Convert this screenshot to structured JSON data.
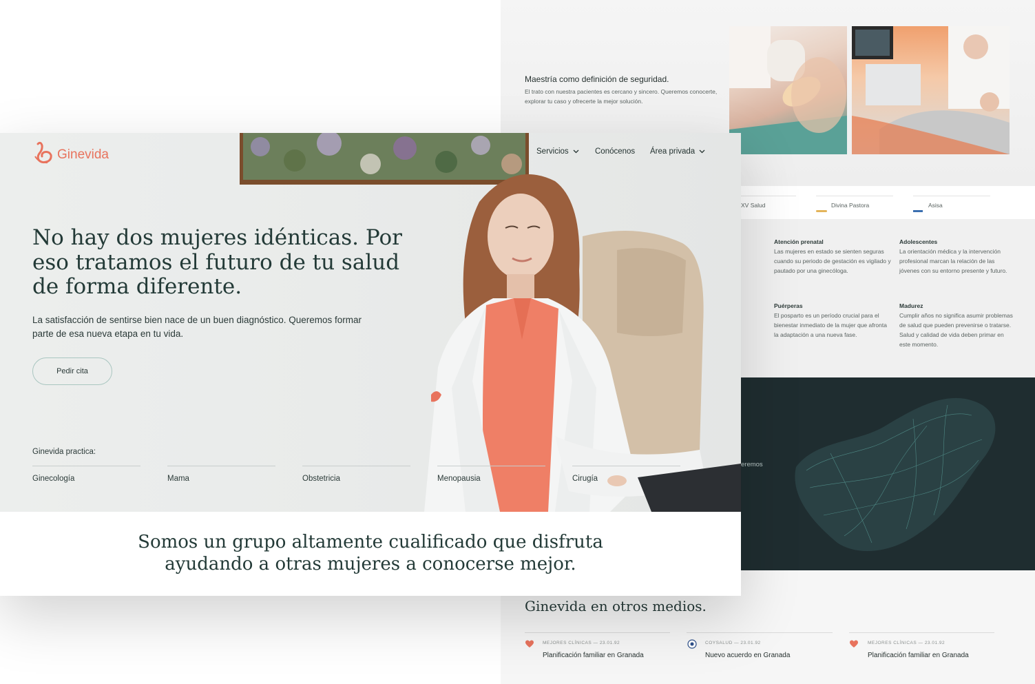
{
  "colors": {
    "accent": "#e8735d",
    "dark_panel": "#1f2d30",
    "text": "#233a37",
    "button_border": "#a9c6c0"
  },
  "back": {
    "feature": {
      "title": "Maestría como definición de seguridad.",
      "text": "El trato con nuestra pacientes es cercano y sincero. Queremos conocerte, explorar tu caso y ofrecerte la mejor solución."
    },
    "partners": [
      "XV Salud",
      "Divina Pastora",
      "Asisa"
    ],
    "services": [
      {
        "title": "Atención prenatal",
        "text": "Las mujeres en estado se sienten seguras cuando su periodo de gestación es vigilado y pautado por una ginecóloga."
      },
      {
        "title": "Adolescentes",
        "text": "La orientación médica y la intervención profesional marcan la relación de las jóvenes con su entorno presente y futuro."
      },
      {
        "title": "Puérperas",
        "text": "El posparto es un período crucial para el bienestar inmediato de la mujer que afronta la adaptación a una nueva fase."
      },
      {
        "title": "Madurez",
        "text": "Cumplir años no significa asumir problemas de salud que pueden prevenirse o tratarse. Salud y calidad de vida deben primar en este momento."
      }
    ],
    "map_fragment": "eremos",
    "media": {
      "title": "Ginevida en otros medios.",
      "items": [
        {
          "meta": "MEJORES CLÍNICAS — 23.01.92",
          "text": "Planificación familiar en Granada",
          "icon": "heart-icon"
        },
        {
          "meta": "COYSALUD — 23.01.92",
          "text": "Nuevo acuerdo en Granada",
          "icon": "coysalud-icon"
        },
        {
          "meta": "MEJORES CLÍNICAS — 23.01.92",
          "text": "Planificación familiar en Granada",
          "icon": "heart-icon"
        }
      ]
    }
  },
  "front": {
    "logo": "Ginevida",
    "nav": [
      "Servicios",
      "Conócenos",
      "Área privada"
    ],
    "headline": "No hay dos mujeres idénticas. Por eso tratamos el futuro de tu salud de forma diferente.",
    "subtext": "La satisfacción de sentirse bien nace de un buen diagnóstico. Queremos formar parte de esa nueva etapa en tu vida.",
    "cta": "Pedir cita",
    "practica_label": "Ginevida practica:",
    "specialties": [
      "Ginecología",
      "Mama",
      "Obstetricia",
      "Menopausia",
      "Cirugía"
    ],
    "coat_logo": "Ginevida",
    "statement": "Somos un grupo altamente cualificado que disfruta ayudando a otras mujeres a conocerse mejor."
  }
}
